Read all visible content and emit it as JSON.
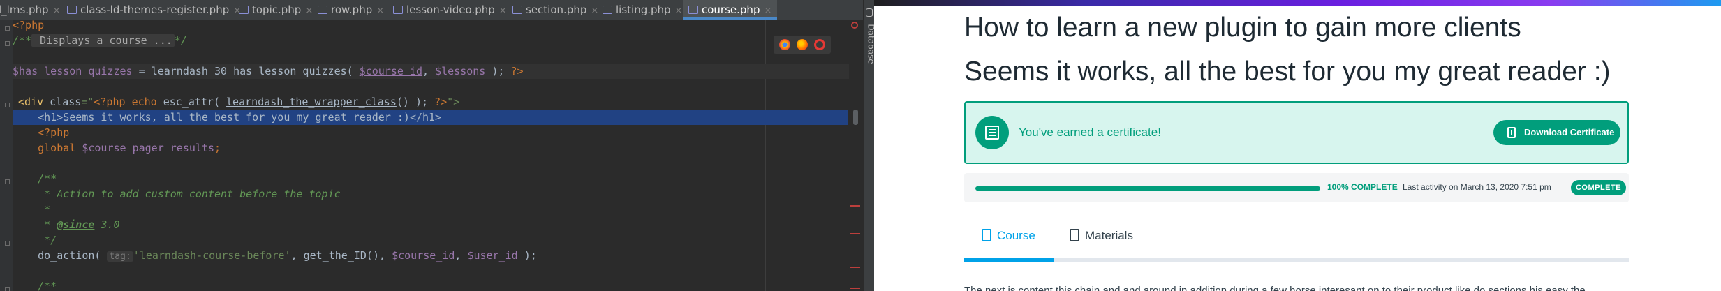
{
  "ide": {
    "tabs": [
      {
        "label": "l_lms.php"
      },
      {
        "label": "class-ld-themes-register.php"
      },
      {
        "label": "topic.php"
      },
      {
        "label": "row.php"
      },
      {
        "label": "lesson-video.php"
      },
      {
        "label": "section.php"
      },
      {
        "label": "listing.php"
      },
      {
        "label": "course.php",
        "active": true
      }
    ],
    "side_panel_label": "Database",
    "code": {
      "l1": "<?php",
      "l2_open": "/**",
      "l2_fold": " Displays a course ...",
      "l2_close": "*/",
      "l4_var": "$has_lesson_quizzes",
      "l4_eq": " = ",
      "l4_fn": "learndash_30_has_lesson_quizzes",
      "l4_paren": "( ",
      "l4_arg1": "$course_id",
      "l4_comma": ", ",
      "l4_arg2": "$lessons",
      "l4_end": " ); ",
      "l4_close": "?>",
      "l6_a": "<div ",
      "l6_attr": "class",
      "l6_eq": "=\"",
      "l6_php": "<?php ",
      "l6_echo": "echo ",
      "l6_fn": "esc_attr",
      "l6_p": "( ",
      "l6_fn2": "learndash_the_wrapper_class",
      "l6_p2": "() ); ",
      "l6_close": "?>",
      "l6_end": "\">",
      "l7": "    <h1>Seems it works, all the best for you my great reader :)</h1>",
      "l8": "    <?php",
      "l9_kw": "    global ",
      "l9_var": "$course_pager_results",
      "l9_end": ";",
      "l11": "    /**",
      "l12": "     * Action to add custom content before the topic",
      "l13": "     *",
      "l14_a": "     * ",
      "l14_tag": "@since",
      "l14_b": " 3.0",
      "l15": "     */",
      "l16_fn": "    do_action( ",
      "l16_hint": "tag:",
      "l16_str": "'learndash-course-before'",
      "l16_mid": ", get_the_ID(), ",
      "l16_v1": "$course_id",
      "l16_c": ", ",
      "l16_v2": "$user_id",
      "l16_end": " );",
      "l18": "    /**"
    }
  },
  "page": {
    "title": "How to learn a new plugin to gain more clients",
    "heading": "Seems it works, all the best for you my great reader :)",
    "certificate": {
      "message": "You've earned a certificate!",
      "button": "Download Certificate"
    },
    "progress": {
      "percent_value": 100,
      "percent_label": "100% COMPLETE",
      "last_activity": "Last activity on March 13, 2020 7:51 pm",
      "status_badge": "COMPLETE"
    },
    "tabs": [
      {
        "label": "Course",
        "active": true
      },
      {
        "label": "Materials",
        "active": false
      }
    ],
    "body_preview": "The next is content this chain and and around in addition during a few horse interesant on to their product like do sections his easy the"
  },
  "colors": {
    "ide_bg": "#2b2b2b",
    "ide_tabbar": "#3c3f41",
    "selection": "#214283",
    "brand_green": "#019e7c",
    "cert_bg": "#d7f5ee",
    "tab_blue": "#00a2e8",
    "title_text": "#1e2a33"
  }
}
